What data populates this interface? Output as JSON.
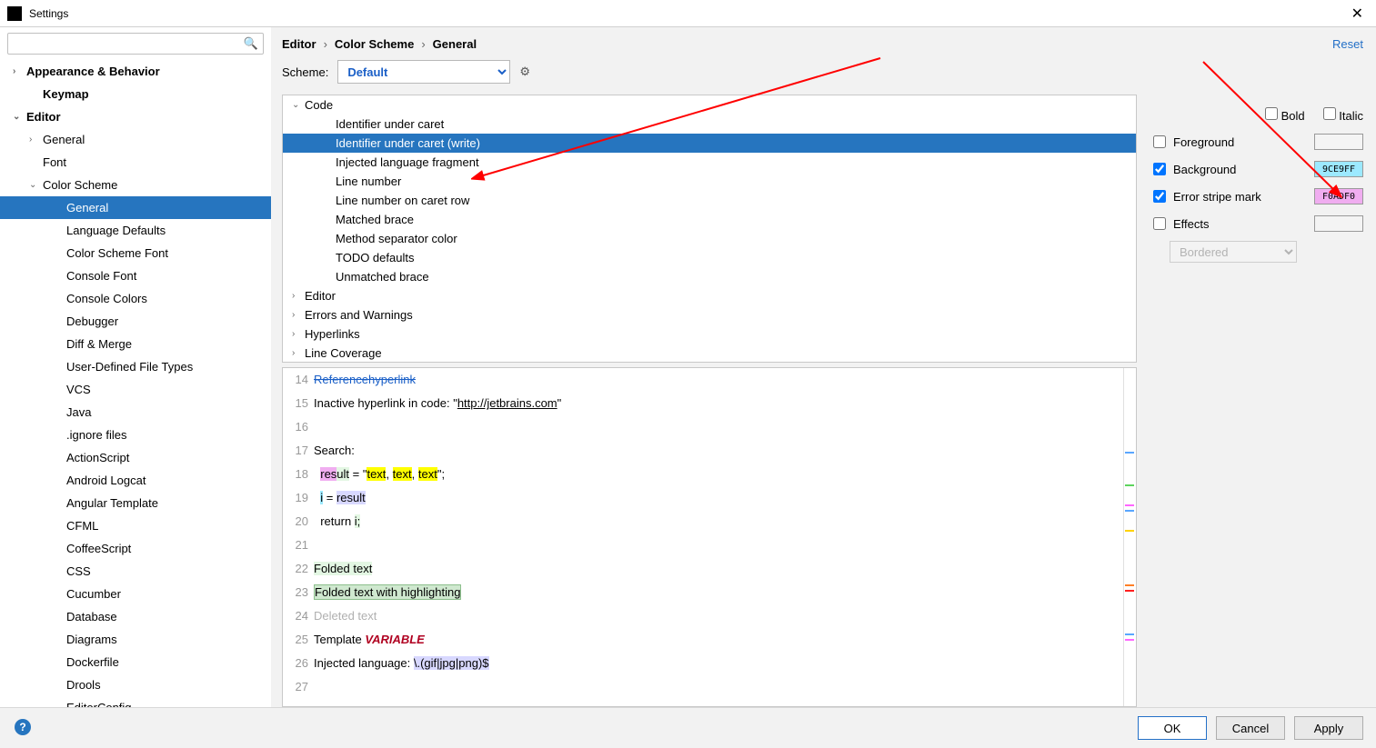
{
  "window": {
    "title": "Settings"
  },
  "search": {
    "placeholder": ""
  },
  "nav": {
    "items": [
      {
        "label": "Appearance & Behavior",
        "depth": 0,
        "bold": true,
        "exp": "›"
      },
      {
        "label": "Keymap",
        "depth": 1,
        "bold": true,
        "exp": ""
      },
      {
        "label": "Editor",
        "depth": 0,
        "bold": true,
        "exp": "⌄"
      },
      {
        "label": "General",
        "depth": 1,
        "exp": "›"
      },
      {
        "label": "Font",
        "depth": 1,
        "exp": ""
      },
      {
        "label": "Color Scheme",
        "depth": 1,
        "exp": "⌄"
      },
      {
        "label": "General",
        "depth": 3,
        "selected": true
      },
      {
        "label": "Language Defaults",
        "depth": 3
      },
      {
        "label": "Color Scheme Font",
        "depth": 3
      },
      {
        "label": "Console Font",
        "depth": 3
      },
      {
        "label": "Console Colors",
        "depth": 3
      },
      {
        "label": "Debugger",
        "depth": 3
      },
      {
        "label": "Diff & Merge",
        "depth": 3
      },
      {
        "label": "User-Defined File Types",
        "depth": 3
      },
      {
        "label": "VCS",
        "depth": 3
      },
      {
        "label": "Java",
        "depth": 3
      },
      {
        "label": ".ignore files",
        "depth": 3
      },
      {
        "label": "ActionScript",
        "depth": 3
      },
      {
        "label": "Android Logcat",
        "depth": 3
      },
      {
        "label": "Angular Template",
        "depth": 3
      },
      {
        "label": "CFML",
        "depth": 3
      },
      {
        "label": "CoffeeScript",
        "depth": 3
      },
      {
        "label": "CSS",
        "depth": 3
      },
      {
        "label": "Cucumber",
        "depth": 3
      },
      {
        "label": "Database",
        "depth": 3
      },
      {
        "label": "Diagrams",
        "depth": 3
      },
      {
        "label": "Dockerfile",
        "depth": 3
      },
      {
        "label": "Drools",
        "depth": 3
      },
      {
        "label": "EditorConfig",
        "depth": 3
      }
    ]
  },
  "breadcrumb": [
    "Editor",
    "Color Scheme",
    "General"
  ],
  "reset": "Reset",
  "scheme": {
    "label": "Scheme:",
    "value": "Default"
  },
  "tree": {
    "items": [
      {
        "label": "Code",
        "exp": "⌄",
        "depth": 0
      },
      {
        "label": "Identifier under caret",
        "depth": 1
      },
      {
        "label": "Identifier under caret (write)",
        "depth": 1,
        "selected": true
      },
      {
        "label": "Injected language fragment",
        "depth": 1
      },
      {
        "label": "Line number",
        "depth": 1
      },
      {
        "label": "Line number on caret row",
        "depth": 1
      },
      {
        "label": "Matched brace",
        "depth": 1
      },
      {
        "label": "Method separator color",
        "depth": 1
      },
      {
        "label": "TODO defaults",
        "depth": 1
      },
      {
        "label": "Unmatched brace",
        "depth": 1
      },
      {
        "label": "Editor",
        "exp": "›",
        "depth": 0
      },
      {
        "label": "Errors and Warnings",
        "exp": "›",
        "depth": 0
      },
      {
        "label": "Hyperlinks",
        "exp": "›",
        "depth": 0
      },
      {
        "label": "Line Coverage",
        "exp": "›",
        "depth": 0
      }
    ]
  },
  "options": {
    "bold": "Bold",
    "italic": "Italic",
    "foreground": "Foreground",
    "background": "Background",
    "backgroundColor": "9CE9FF",
    "errorstripe": "Error stripe mark",
    "errorstripeColor": "F0ADF0",
    "effects": "Effects",
    "effectsType": "Bordered"
  },
  "code": {
    "lines": [
      {
        "n": 14,
        "html": "<a style='text-decoration:line-through'>Referencehyperlink</a>"
      },
      {
        "n": 15,
        "html": "Inactive hyperlink in code: \"<u>http://jetbrains.com</u>\""
      },
      {
        "n": 16,
        "html": ""
      },
      {
        "n": 17,
        "html": "Search:"
      },
      {
        "n": 18,
        "html": "  <span class='hl-pink'>res</span><span class='hl-green'>ult</span> = \"<span class='hl-yellow'>text</span>, <span class='hl-yellow'>text</span>, <span class='hl-yellow'>text</span>\";"
      },
      {
        "n": 19,
        "html": "  <span class='hl-blue'>i</span> = <span class='hl-lav'>result</span>"
      },
      {
        "n": 20,
        "html": "  return <span class='hl-green'>i;</span>"
      },
      {
        "n": 21,
        "html": ""
      },
      {
        "n": 22,
        "html": "<span class='hl-green'>Folded text</span>"
      },
      {
        "n": 23,
        "html": "<span class='hl-sel'>Folded text with highlighting</span>"
      },
      {
        "n": 24,
        "html": "<span class='gray'>Deleted text</span>"
      },
      {
        "n": 25,
        "html": "Template <span class='red'>VARIABLE</span>"
      },
      {
        "n": 26,
        "html": "Injected language: <span class='hl-lav'>\\.(gif|jpg|png)$</span>"
      },
      {
        "n": 27,
        "html": ""
      }
    ]
  },
  "buttons": {
    "ok": "OK",
    "cancel": "Cancel",
    "apply": "Apply"
  },
  "colors": {
    "selection": "#2675bf",
    "swatch_bg": "#9CE9FF",
    "swatch_stripe": "#F0ADF0"
  }
}
